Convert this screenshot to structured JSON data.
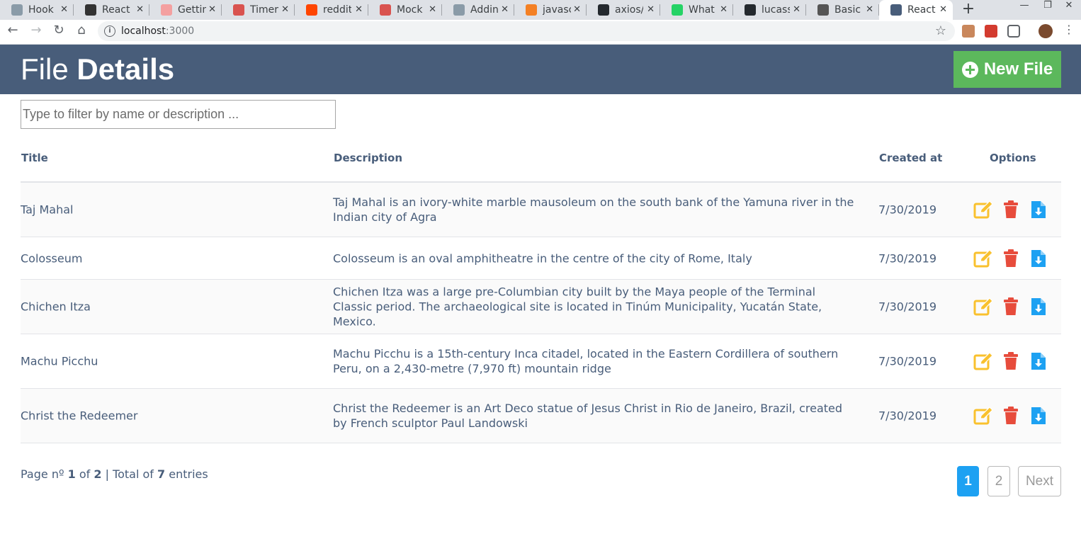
{
  "browser": {
    "tabs": [
      {
        "label": "Hook",
        "icon": "react-icon",
        "color": "#8a9ba8"
      },
      {
        "label": "React",
        "icon": "medium-icon",
        "color": "#333333"
      },
      {
        "label": "Gettin",
        "icon": "flower-icon",
        "color": "#f4a0a0"
      },
      {
        "label": "Timer",
        "icon": "sketch-icon",
        "color": "#d9534f"
      },
      {
        "label": "reddit",
        "icon": "reddit-icon",
        "color": "#ff4500"
      },
      {
        "label": "Mock",
        "icon": "sketch-icon",
        "color": "#d9534f"
      },
      {
        "label": "Addin",
        "icon": "react-icon",
        "color": "#8a9ba8"
      },
      {
        "label": "javasc",
        "icon": "stackoverflow-icon",
        "color": "#f48024"
      },
      {
        "label": "axios/",
        "icon": "github-icon",
        "color": "#24292e"
      },
      {
        "label": "What",
        "icon": "whatsapp-icon",
        "color": "#25d366"
      },
      {
        "label": "lucass",
        "icon": "github-icon",
        "color": "#24292e"
      },
      {
        "label": "Basic",
        "icon": "markdown-icon",
        "color": "#555555"
      },
      {
        "label": "React",
        "icon": "react-icon",
        "color": "#485d7a",
        "active": true
      }
    ],
    "url_host": "localhost",
    "url_port": ":3000"
  },
  "header": {
    "title_light": "File",
    "title_bold": "Details",
    "new_button_label": "New File"
  },
  "filter": {
    "placeholder": "Type to filter by name or description ...",
    "value": ""
  },
  "table": {
    "columns": {
      "title": "Title",
      "description": "Description",
      "created_at": "Created at",
      "options": "Options"
    },
    "rows": [
      {
        "title": "Taj Mahal",
        "description": "Taj Mahal is an ivory-white marble mausoleum on the south bank of the Yamuna river in the Indian city of Agra",
        "created_at": "7/30/2019"
      },
      {
        "title": "Colosseum",
        "description": "Colosseum is an oval amphitheatre in the centre of the city of Rome, Italy",
        "created_at": "7/30/2019"
      },
      {
        "title": "Chichen Itza",
        "description": "Chichen Itza was a large pre-Columbian city built by the Maya people of the Terminal Classic period. The archaeological site is located in Tinúm Municipality, Yucatán State, Mexico.",
        "created_at": "7/30/2019"
      },
      {
        "title": "Machu Picchu",
        "description": "Machu Picchu is a 15th-century Inca citadel, located in the Eastern Cordillera of southern Peru, on a 2,430-metre (7,970 ft) mountain ridge",
        "created_at": "7/30/2019"
      },
      {
        "title": "Christ the Redeemer",
        "description": "Christ the Redeemer is an Art Deco statue of Jesus Christ in Rio de Janeiro, Brazil, created by French sculptor Paul Landowski",
        "created_at": "7/30/2019"
      }
    ]
  },
  "pagination": {
    "prefix": "Page nº",
    "current": "1",
    "of_label": "of",
    "total_pages": "2",
    "total_label": "| Total of",
    "total_entries": "7",
    "entries_label": "entries",
    "pages": [
      "1",
      "2"
    ],
    "next_label": "Next"
  },
  "colors": {
    "header_bg": "#485d7a",
    "new_button": "#5cb85c",
    "edit_icon": "#f9c12e",
    "delete_icon": "#e74c3c",
    "download_icon": "#1da1f2",
    "active_page": "#1da1f2"
  }
}
